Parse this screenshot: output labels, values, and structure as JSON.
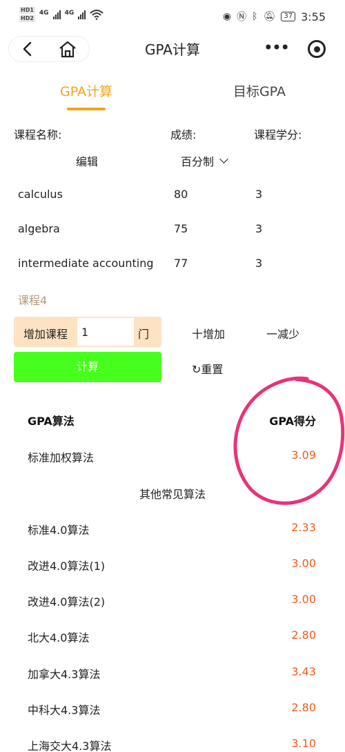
{
  "status_bar": {
    "hd1": "HD1",
    "hd2": "HD2",
    "net1": "4G",
    "net2": "4G",
    "battery": "37",
    "time": "3:55"
  },
  "nav": {
    "title": "GPA计算",
    "more": "•••"
  },
  "tabs": [
    {
      "label": "GPA计算",
      "active": true
    },
    {
      "label": "目标GPA",
      "active": false
    }
  ],
  "table": {
    "headers": [
      "课程名称:",
      "成绩:",
      "课程学分:"
    ],
    "edit_label": "编辑",
    "grade_system": "百分制",
    "courses": [
      {
        "name": "calculus",
        "score": "80",
        "credit": "3"
      },
      {
        "name": "algebra",
        "score": "75",
        "credit": "3"
      },
      {
        "name": "intermediate accounting",
        "score": "77",
        "credit": "3"
      }
    ],
    "next_course_placeholder": "课程4"
  },
  "controls": {
    "add_label": "增加课程",
    "add_count": "1",
    "add_unit": "门",
    "increase": "十增加",
    "decrease": "一减少",
    "calculate": "计算",
    "reset": "重置",
    "reset_icon": "↻"
  },
  "results": {
    "header_method": "GPA算法",
    "header_score": "GPA得分",
    "main": {
      "name": "标准加权算法",
      "value": "3.09"
    },
    "other_title": "其他常见算法",
    "others": [
      {
        "name": "标准4.0算法",
        "value": "2.33"
      },
      {
        "name": "改进4.0算法(1)",
        "value": "3.00"
      },
      {
        "name": "改进4.0算法(2)",
        "value": "3.00"
      },
      {
        "name": "北大4.0算法",
        "value": "2.80"
      },
      {
        "name": "加拿大4.3算法",
        "value": "3.43"
      },
      {
        "name": "中科大4.3算法",
        "value": "2.80"
      },
      {
        "name": "上海交大4.3算法",
        "value": "3.10"
      }
    ]
  },
  "colors": {
    "accent": "#f5a31a",
    "calc_button": "#47ff1c",
    "score_value": "#f25a1a",
    "annotation": "#e8337a"
  }
}
